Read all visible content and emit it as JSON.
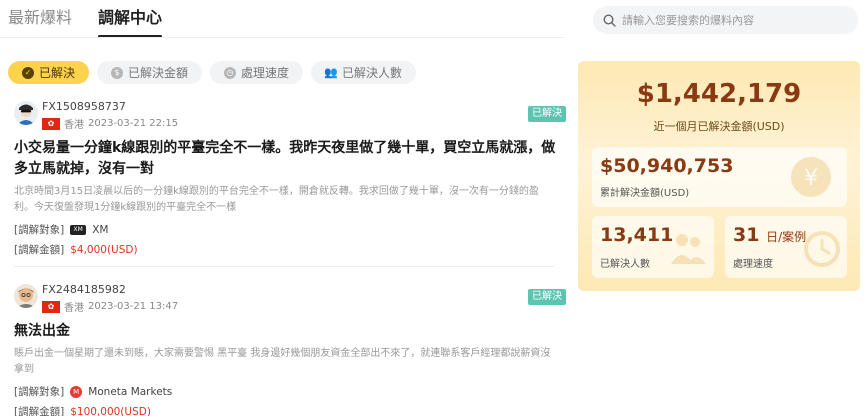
{
  "tabs": [
    {
      "label": "最新爆料",
      "active": false
    },
    {
      "label": "調解中心",
      "active": true
    }
  ],
  "search": {
    "placeholder": "請輸入您要搜索的爆料內容"
  },
  "filters": [
    {
      "label": "已解決",
      "icon": "check-circle-icon",
      "active": true
    },
    {
      "label": "已解決金額",
      "icon": "dollar-circle-icon",
      "active": false
    },
    {
      "label": "處理速度",
      "icon": "clock-icon",
      "active": false
    },
    {
      "label": "已解決人數",
      "icon": "people-icon",
      "active": false
    }
  ],
  "cases": [
    {
      "user_id": "FX1508958737",
      "region": "香港",
      "datetime": "2023-03-21 22:15",
      "badge": "已解決",
      "title": "小交易量一分鐘k線跟別的平臺完全不一樣。我昨天夜里做了幾十單，買空立馬就漲，做多立馬就掉，沒有一對",
      "summary": "北京時間3月15日凌晨以后的一分鐘k線跟別的平台完全不一樣，開倉就反轉。我求回做了幾十單，沒一次有一分錢的盈利。今天復盤發現1分鐘k線跟別的平臺完全不一樣",
      "target_label": "[調解對象]",
      "target_name": "XM",
      "target_logo": "XM",
      "amount_label": "[調解金額]",
      "amount": "$4,000(USD)"
    },
    {
      "user_id": "FX2484185982",
      "region": "香港",
      "datetime": "2023-03-21 13:47",
      "badge": "已解決",
      "title": "無法出金",
      "summary": "賬戶出金一個星期了還未到賬，大家需要警惕 黑平臺 我身邊好幾個朋友資金全部出不來了，就連聯系客戶經理都說薪資沒拿到",
      "target_label": "[調解對象]",
      "target_name": "Moneta Markets",
      "target_logo": "M",
      "amount_label": "[調解金額]",
      "amount": "$100,000(USD)"
    }
  ],
  "stats": {
    "monthly_amount": "$1,442,179",
    "monthly_label": "近一個月已解決金額(USD)",
    "total_amount": "$50,940,753",
    "total_label": "累計解決金額(USD)",
    "people_count": "13,411",
    "people_label": "已解決人數",
    "speed_value": "31",
    "speed_unit": "日/案例",
    "speed_label": "處理速度"
  },
  "colors": {
    "accent": "#fcd34d",
    "badge": "#5cc5b1",
    "amount_red": "#e0321d",
    "stat_brown": "#8a3a12"
  }
}
